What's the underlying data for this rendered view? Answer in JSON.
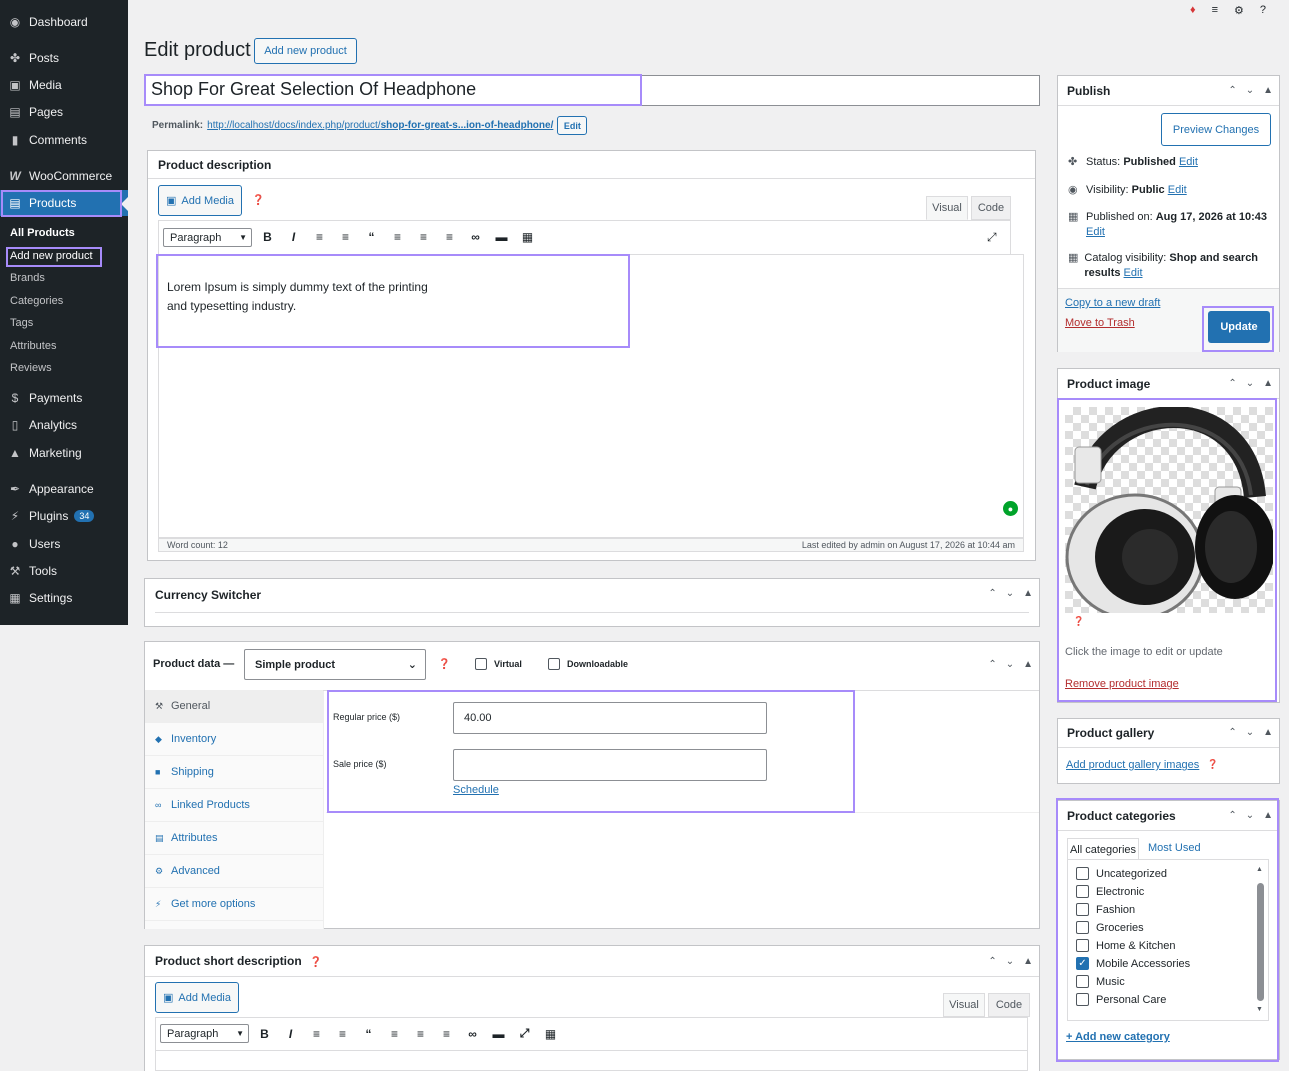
{
  "sidebar": {
    "dashboard": "Dashboard",
    "posts": "Posts",
    "media": "Media",
    "pages": "Pages",
    "comments": "Comments",
    "woocommerce": "WooCommerce",
    "products": "Products",
    "sub": [
      "All Products",
      "Add new product",
      "Brands",
      "Categories",
      "Tags",
      "Attributes",
      "Reviews"
    ],
    "payments": "Payments",
    "analytics": "Analytics",
    "marketing": "Marketing",
    "appearance": "Appearance",
    "plugins": "Plugins",
    "plugins_badge": "34",
    "users": "Users",
    "tools": "Tools",
    "settings": "Settings"
  },
  "header": {
    "title": "Edit product",
    "add_new": "Add new product"
  },
  "post": {
    "title": "Shop For Great Selection Of Headphone",
    "permalink_label": "Permalink:",
    "permalink_base": "http://localhost/docs/index.php/product/",
    "permalink_slug": "shop-for-great-s...ion-of-headphone/",
    "permalink_edit": "Edit"
  },
  "description": {
    "title": "Product description",
    "add_media": "Add Media",
    "tab_visual": "Visual",
    "tab_code": "Code",
    "format": "Paragraph",
    "line1": "Lorem Ipsum is simply dummy text of the printing",
    "line2": "and typesetting industry.",
    "word_count": "Word count: 12",
    "last_edited": "Last edited by admin on August 17, 2026 at 10:44 am"
  },
  "currency": {
    "title": "Currency Switcher"
  },
  "product_data": {
    "title": "Product data —",
    "type": "Simple product",
    "virtual": "Virtual",
    "downloadable": "Downloadable",
    "tabs": [
      "General",
      "Inventory",
      "Shipping",
      "Linked Products",
      "Attributes",
      "Advanced",
      "Get more options"
    ],
    "regular_price_label": "Regular price ($)",
    "regular_price": "40.00",
    "sale_price_label": "Sale price ($)",
    "sale_price": "",
    "schedule": "Schedule"
  },
  "short_desc": {
    "title": "Product short description",
    "add_media": "Add Media",
    "tab_visual": "Visual",
    "tab_code": "Code",
    "format": "Paragraph"
  },
  "publish": {
    "title": "Publish",
    "preview": "Preview Changes",
    "status_label": "Status:",
    "status": "Published",
    "visibility_label": "Visibility:",
    "visibility": "Public",
    "published_label": "Published on:",
    "published": "Aug 17, 2026 at 10:43",
    "catalog_label": "Catalog visibility:",
    "catalog": "Shop and search results",
    "edit": "Edit",
    "copy_draft": "Copy to a new draft",
    "trash": "Move to Trash",
    "update": "Update"
  },
  "product_image": {
    "title": "Product image",
    "hint": "Click the image to edit or update",
    "remove": "Remove product image"
  },
  "gallery": {
    "title": "Product gallery",
    "add": "Add product gallery images"
  },
  "categories": {
    "title": "Product categories",
    "tab_all": "All categories",
    "tab_most": "Most Used",
    "items": [
      {
        "name": "Uncategorized",
        "checked": false
      },
      {
        "name": "Electronic",
        "checked": false
      },
      {
        "name": "Fashion",
        "checked": false
      },
      {
        "name": "Groceries",
        "checked": false
      },
      {
        "name": "Home & Kitchen",
        "checked": false
      },
      {
        "name": "Mobile Accessories",
        "checked": true
      },
      {
        "name": "Music",
        "checked": false
      },
      {
        "name": "Personal Care",
        "checked": false
      }
    ],
    "add_new": "+ Add new category"
  },
  "colors": {
    "accent": "#2271b1",
    "highlight": "#a78bfa",
    "sidebar": "#1d2327"
  }
}
